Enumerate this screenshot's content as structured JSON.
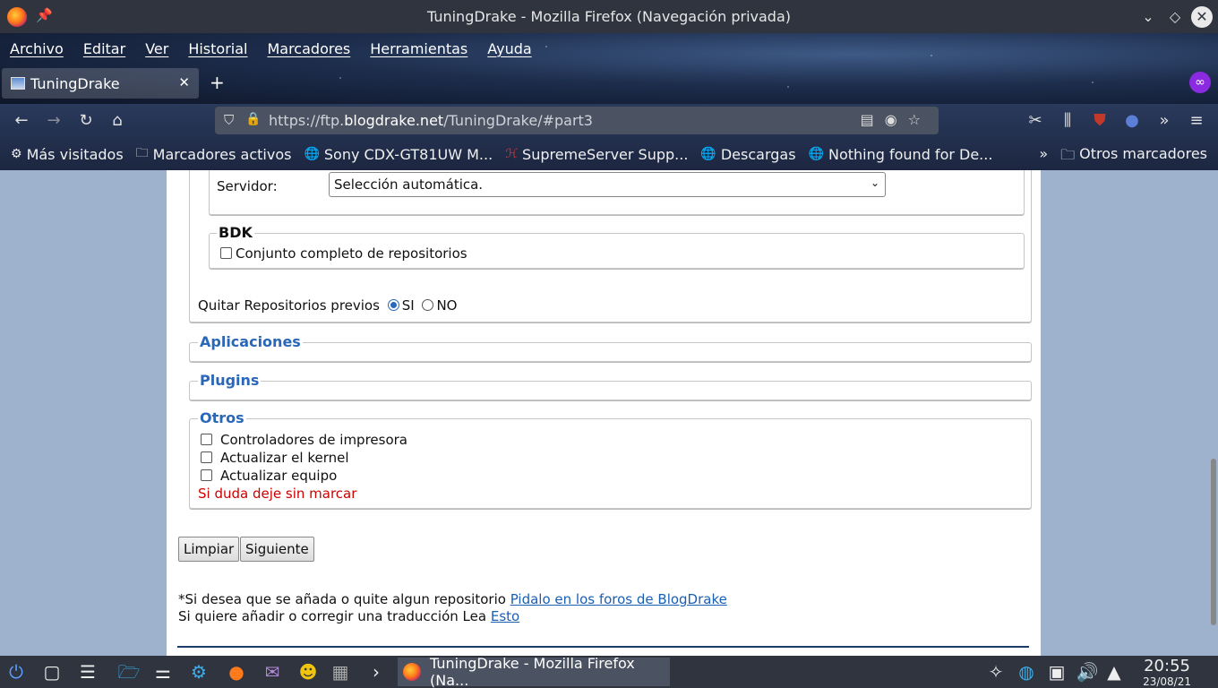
{
  "window": {
    "title": "TuningDrake - Mozilla Firefox (Navegación privada)"
  },
  "menu": [
    "Archivo",
    "Editar",
    "Ver",
    "Historial",
    "Marcadores",
    "Herramientas",
    "Ayuda"
  ],
  "tab": {
    "label": "TuningDrake"
  },
  "url": {
    "prefix": "https://ftp.",
    "domain": "blogdrake.net",
    "path": "/TuningDrake/#part3"
  },
  "bookmarks": [
    {
      "icon": "gear-icon",
      "label": "Más visitados"
    },
    {
      "icon": "folder-icon",
      "label": "Marcadores activos"
    },
    {
      "icon": "globe-icon",
      "label": "Sony CDX-GT81UW M..."
    },
    {
      "icon": "logo-icon",
      "label": "SupremeServer Supp..."
    },
    {
      "icon": "globe-icon",
      "label": "Descargas"
    },
    {
      "icon": "globe-icon",
      "label": "Nothing found for De..."
    }
  ],
  "other_bookmarks": "Otros marcadores",
  "form": {
    "server_label": "Servidor:",
    "server_value": "Selección automática.",
    "bdk_legend": "BDK",
    "bdk_option": "Conjunto completo de repositorios",
    "remove_label": "Quitar Repositorios previos",
    "radio_si": "SI",
    "radio_no": "NO",
    "apps_legend": "Aplicaciones",
    "plugins_legend": "Plugins",
    "otros_legend": "Otros",
    "otros_items": [
      "Controladores de impresora",
      "Actualizar el kernel",
      "Actualizar equipo"
    ],
    "hint": "Si duda deje sin marcar",
    "btn_clear": "Limpiar",
    "btn_next": "Siguiente",
    "note1_text": "*Si desea que se añada o quite algun repositorio ",
    "note1_link": "Pidalo en los foros de BlogDrake",
    "note2_text": "Si quiere añadir o corregir una traducción Lea ",
    "note2_link": "Esto"
  },
  "taskbar": {
    "task_label": "TuningDrake - Mozilla Firefox (Na...",
    "time": "20:55",
    "date": "23/08/21"
  }
}
